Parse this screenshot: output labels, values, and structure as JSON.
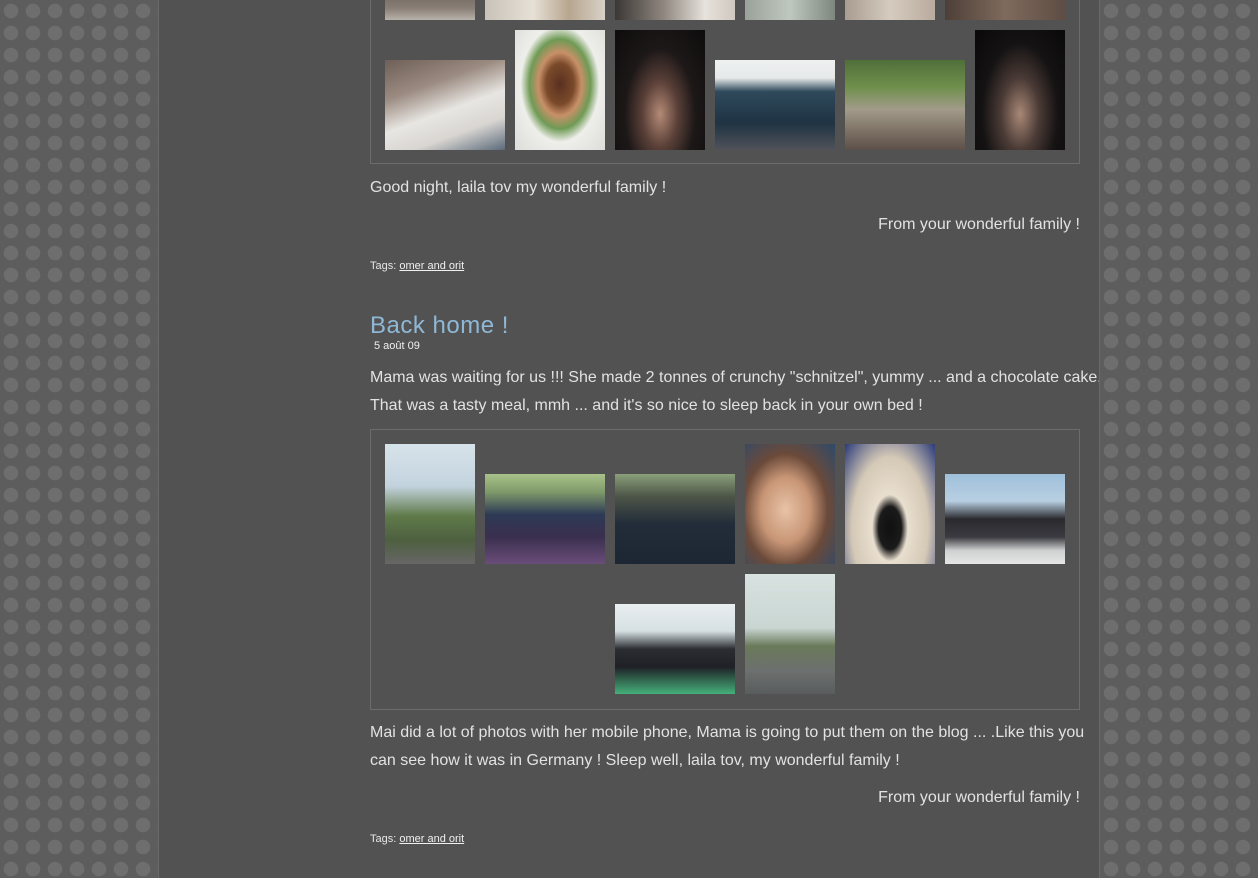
{
  "post1": {
    "closing_text": "Good night, laila tov my wonderful family !",
    "signature": "From your wonderful family !",
    "tags_label": "Tags:",
    "tag": "omer and orit"
  },
  "post2": {
    "title": "Back home !",
    "date": "5 août 09",
    "body_line1": "Mama was waiting for us !!! She made 2 tonnes of crunchy \"schnitzel\", yummy ... and a chocolate cake.",
    "body_line2": "That was a tasty meal, mmh ... and it's so nice to sleep back in your own bed !",
    "footer_line1": "Mai did a lot of photos with her mobile phone, Mama is going to put them on the blog ... .Like this you",
    "footer_line2": "can see how it was in Germany ! Sleep well, laila tov, my wonderful family !",
    "signature": "From your wonderful family !",
    "tags_label": "Tags:",
    "tag": "omer and orit"
  }
}
